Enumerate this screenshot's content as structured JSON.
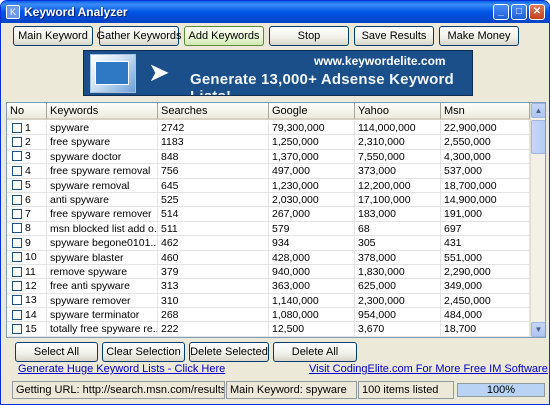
{
  "window": {
    "title": "Keyword Analyzer"
  },
  "toolbar": {
    "main_keyword": "Main Keyword",
    "gather_keywords": "Gather Keywords",
    "add_keywords": "Add Keywords",
    "stop": "Stop",
    "save_results": "Save Results",
    "make_money": "Make Money"
  },
  "banner": {
    "url": "www.keywordelite.com",
    "headline": "Generate 13,000+ Adsense Keyword Lists!",
    "icon": "cursor-arrow-icon"
  },
  "grid": {
    "columns": [
      "No",
      "Keywords",
      "Searches",
      "Google",
      "Yahoo",
      "Msn"
    ],
    "rows": [
      [
        "1",
        "spyware",
        "2742",
        "79,300,000",
        "114,000,000",
        "22,900,000"
      ],
      [
        "2",
        "free spyware",
        "1183",
        "1,250,000",
        "2,310,000",
        "2,550,000"
      ],
      [
        "3",
        "spyware doctor",
        "848",
        "1,370,000",
        "7,550,000",
        "4,300,000"
      ],
      [
        "4",
        "free spyware removal",
        "756",
        "497,000",
        "373,000",
        "537,000"
      ],
      [
        "5",
        "spyware removal",
        "645",
        "1,230,000",
        "12,200,000",
        "18,700,000"
      ],
      [
        "6",
        "anti spyware",
        "525",
        "2,030,000",
        "17,100,000",
        "14,900,000"
      ],
      [
        "7",
        "free spyware remover",
        "514",
        "267,000",
        "183,000",
        "191,000"
      ],
      [
        "8",
        "msn blocked list add o...",
        "511",
        "579",
        "68",
        "697"
      ],
      [
        "9",
        "spyware begone0101...",
        "462",
        "934",
        "305",
        "431"
      ],
      [
        "10",
        "spyware blaster",
        "460",
        "428,000",
        "378,000",
        "551,000"
      ],
      [
        "11",
        "remove spyware",
        "379",
        "940,000",
        "1,830,000",
        "2,290,000"
      ],
      [
        "12",
        "free anti spyware",
        "313",
        "363,000",
        "625,000",
        "349,000"
      ],
      [
        "13",
        "spyware remover",
        "310",
        "1,140,000",
        "2,300,000",
        "2,450,000"
      ],
      [
        "14",
        "spyware terminator",
        "268",
        "1,080,000",
        "954,000",
        "484,000"
      ],
      [
        "15",
        "totally free spyware re...",
        "222",
        "12,500",
        "3,670",
        "18,700"
      ]
    ]
  },
  "actions": {
    "select_all": "Select All",
    "clear_selection": "Clear Selection",
    "delete_selected": "Delete Selected",
    "delete_all": "Delete All"
  },
  "links": {
    "huge_lists": "Generate Huge Keyword Lists - Click Here",
    "codingelite": "Visit CodingElite.com For More Free IM Software"
  },
  "status": {
    "url": "Getting URL: http://search.msn.com/results.aspx?q=",
    "main_keyword": "Main Keyword: spyware",
    "items": "100 items listed",
    "progress_text": "100%",
    "progress_fraction": 1.0
  }
}
